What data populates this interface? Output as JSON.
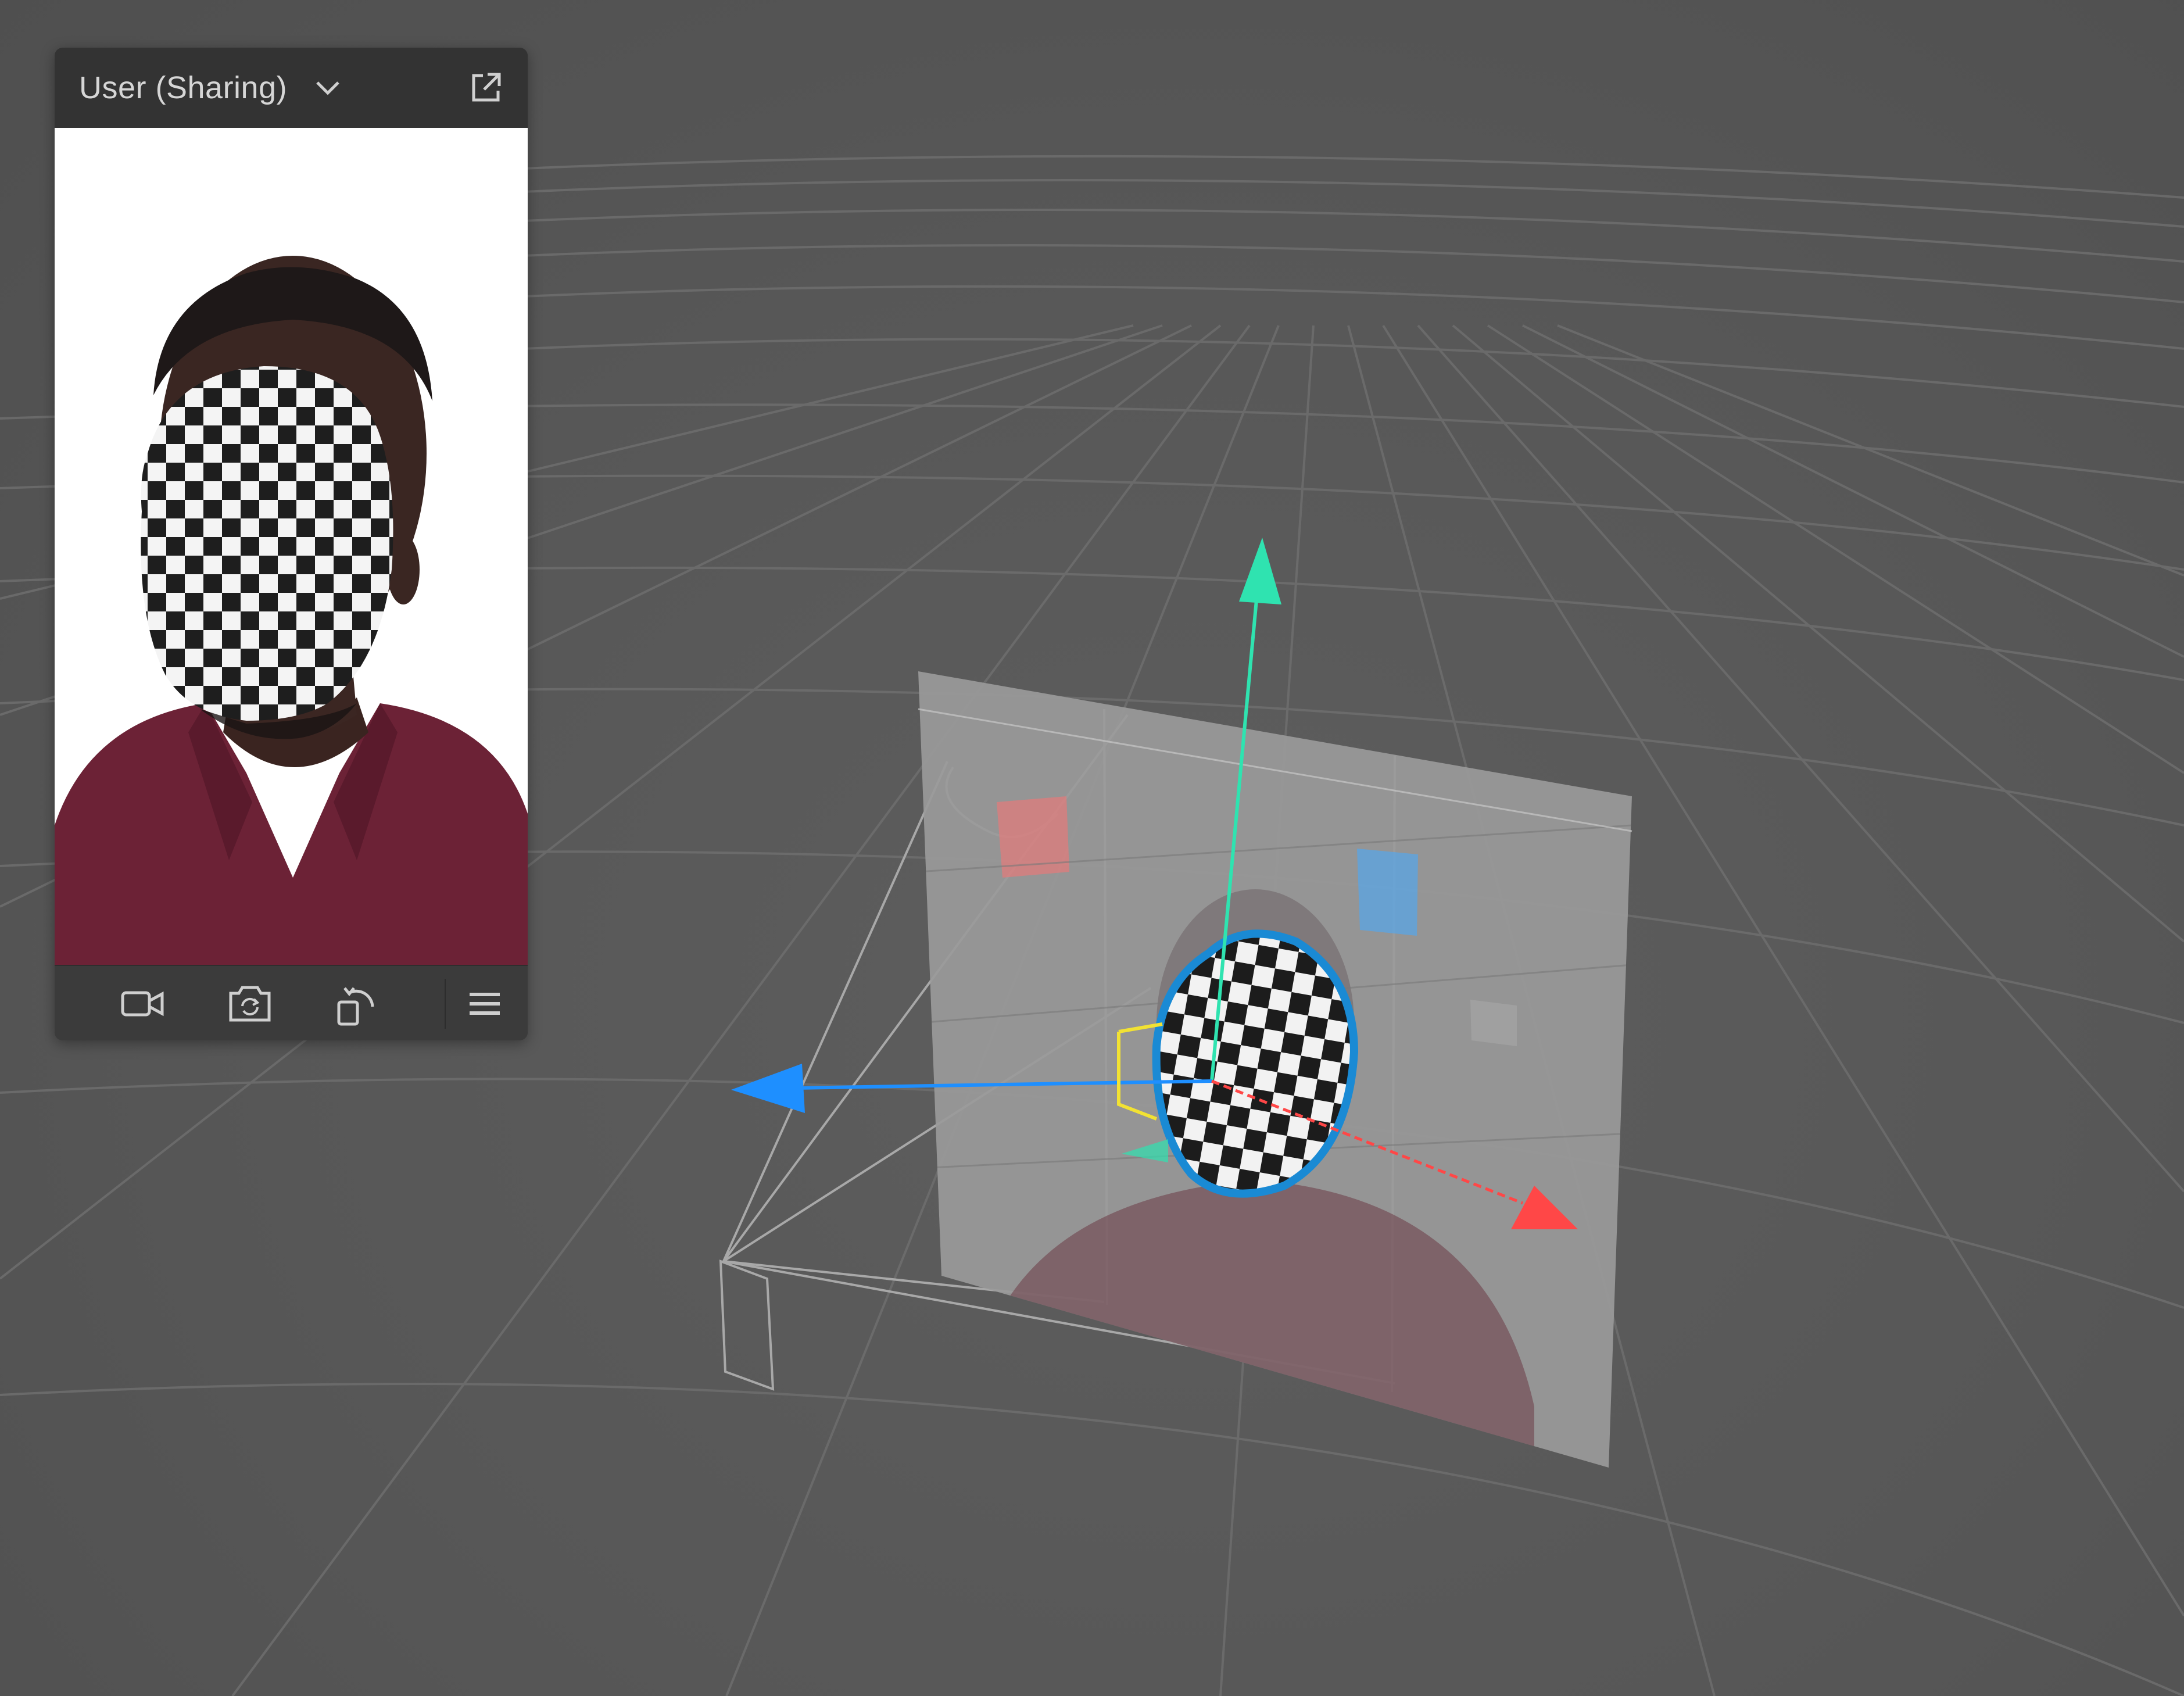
{
  "preview": {
    "source_label": "User (Sharing)",
    "icons": {
      "dropdown": "chevron-down-icon",
      "popout": "external-link-icon",
      "camera": "video-camera-icon",
      "switch_camera": "switch-camera-icon",
      "rotate": "rotate-device-icon",
      "menu": "hamburger-menu-icon"
    }
  },
  "colors": {
    "viewport_bg": "#595959",
    "panel_header": "#333333",
    "panel_toolbar": "#3b3b3b",
    "axis_y": "#2fe3b0",
    "axis_x": "#1e8fff",
    "axis_z": "#ff4747",
    "selection_outline": "#1a8ad4",
    "scale_handle": "#f2e233"
  }
}
